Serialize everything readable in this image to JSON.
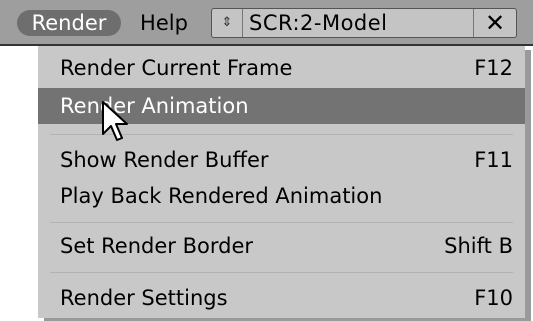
{
  "header": {
    "menus": [
      {
        "label": "Render",
        "active": true
      },
      {
        "label": "Help",
        "active": false
      }
    ],
    "screen_selector": {
      "arrows_glyph": "⇕",
      "name": "SCR:2-Model",
      "close_glyph": "✕"
    }
  },
  "dropdown": {
    "items": [
      {
        "label": "Render Current Frame",
        "shortcut": "F12",
        "highlighted": false
      },
      {
        "label": "Render Animation",
        "shortcut": "",
        "highlighted": true
      },
      {
        "label": "Show Render Buffer",
        "shortcut": "F11",
        "highlighted": false
      },
      {
        "label": "Play Back Rendered Animation",
        "shortcut": "",
        "highlighted": false
      },
      {
        "label": "Set Render Border",
        "shortcut": "Shift B",
        "highlighted": false
      },
      {
        "label": "Render Settings",
        "shortcut": "F10",
        "highlighted": false
      }
    ]
  },
  "colors": {
    "header_bg": "#9e9e9e",
    "active_menu_bg": "#6e6e6e",
    "menu_bg": "#c8c8c8",
    "highlight_bg": "#737373"
  },
  "icons": {
    "cursor": "mouse-pointer-icon",
    "screen_arrows": "up-down-arrows-icon",
    "close": "close-icon"
  }
}
